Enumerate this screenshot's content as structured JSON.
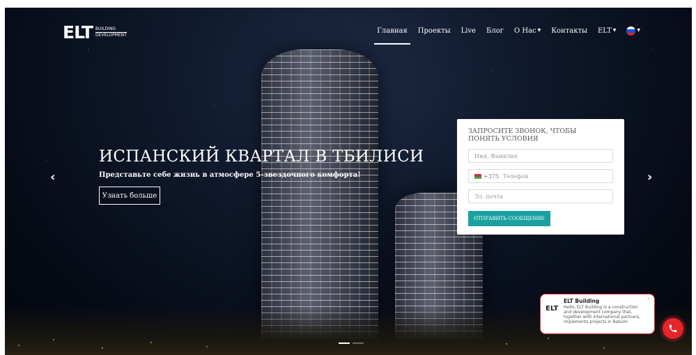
{
  "header": {
    "logo_mark": "ELT",
    "logo_line1": "BUILDING",
    "logo_line2": "DEVELOPMENT",
    "nav": {
      "home": "Главная",
      "projects": "Проекты",
      "live": "Live",
      "blog": "Блог",
      "about": "О Нас",
      "contacts": "Контакты",
      "elt": "ELT"
    }
  },
  "hero": {
    "title": "ИСПАНСКИЙ КВАРТАЛ В ТБИЛИСИ",
    "subtitle": "Представьте себе жизнь в атмосфере 5-звездочного комфорта!",
    "button": "Узнать больше",
    "prev": "‹",
    "next": "›"
  },
  "form": {
    "title": "ЗАПРОСИТЕ ЗВОНОК, ЧТОБЫ ПОНЯТЬ УСЛОВИЯ",
    "name_placeholder": "Имя, Фамилия",
    "phone_code": "+375",
    "phone_placeholder": "Телефон",
    "email_placeholder": "Эл. почта",
    "submit": "ОТПРАВИТЬ СООБЩЕНИЕ"
  },
  "chat": {
    "logo": "ELT",
    "name": "ELT Building",
    "message": "Hello, ELT Building is a construction and development company that, together with international partners, implements projects in Batumi",
    "close": "×"
  },
  "colors": {
    "accent": "#1aa0a0",
    "call_button": "#e5252a"
  },
  "icons": {
    "language_flag": "russia-flag-icon",
    "call": "phone-icon"
  }
}
